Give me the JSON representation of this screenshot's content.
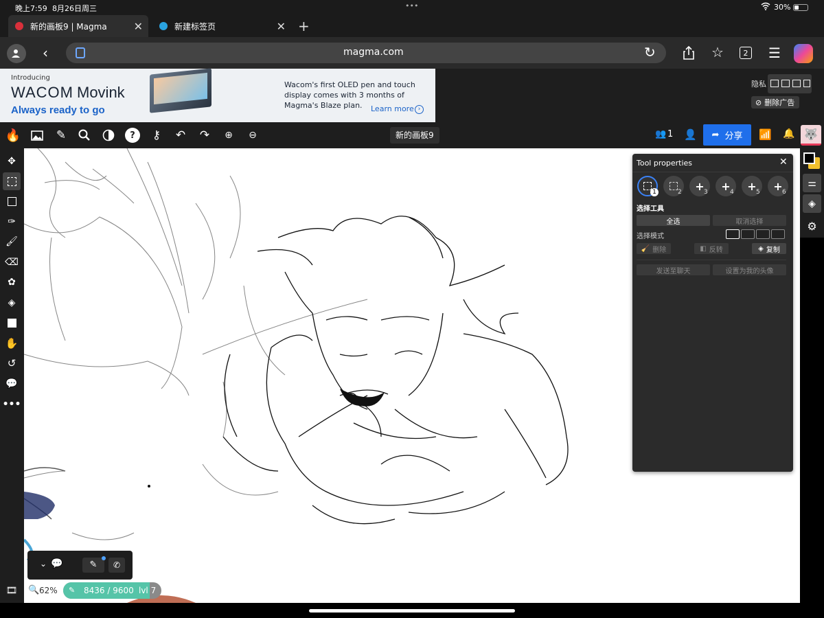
{
  "status_bar": {
    "time": "晚上7:59",
    "date": "8月26日周三",
    "dots": "•••",
    "battery": "30%"
  },
  "tabs": [
    {
      "title": "新的画板9 | Magma",
      "active": true
    },
    {
      "title": "新建标签页",
      "active": false
    }
  ],
  "url_bar": {
    "url": "magma.com",
    "tab_count": "2"
  },
  "ad": {
    "introducing": "Introducing",
    "brand": "WACOM",
    "product": "Movink",
    "tagline": "Always ready to go",
    "body": "Wacom's first OLED pen and touch display comes with 3 months of Magma's Blaze plan.",
    "learn_more": "Learn more",
    "privacy": "隐私",
    "remove_ad": "删除广告"
  },
  "app_toolbar": {
    "board_name": "新的画板9",
    "users_count": "1",
    "share": "分享"
  },
  "tool_properties": {
    "title": "Tool properties",
    "slots": [
      "1",
      "2",
      "3",
      "4",
      "5",
      "6"
    ],
    "section": "选择工具",
    "select_all": "全选",
    "deselect": "取消选择",
    "mode_label": "选择模式",
    "delete": "删除",
    "invert": "反转",
    "copy": "复制",
    "send_chat": "发送至聊天",
    "set_avatar": "设置为我的头像"
  },
  "footer": {
    "zoom": "62%",
    "storage": "8436 / 9600",
    "level": "lvl 7"
  },
  "colors": {
    "accent_blue": "#1f6feb",
    "canvas": "#ffffff",
    "ui_dark": "#1e1e1e",
    "storage_green": "#55c4a8"
  }
}
